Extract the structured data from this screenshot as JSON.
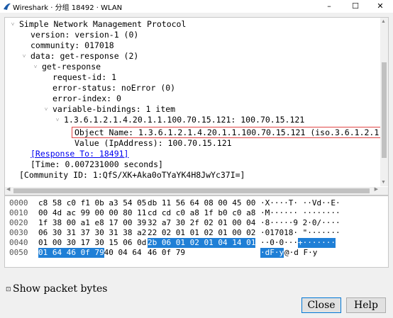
{
  "window": {
    "title": "Wireshark · 分组 18492 · WLAN",
    "minimize": "–",
    "maximize": "☐",
    "close": "✕"
  },
  "tree": {
    "rows": [
      {
        "arrow": "˅",
        "text": "Simple Network Management Protocol"
      },
      {
        "arrow": "",
        "text": "version: version-1 (0)"
      },
      {
        "arrow": "",
        "text": "community: 017018"
      },
      {
        "arrow": "˅",
        "text": "data: get-response (2)"
      },
      {
        "arrow": "˅",
        "text": "get-response"
      },
      {
        "arrow": "",
        "text": "request-id: 1"
      },
      {
        "arrow": "",
        "text": "error-status: noError (0)"
      },
      {
        "arrow": "",
        "text": "error-index: 0"
      },
      {
        "arrow": "˅",
        "text": "variable-bindings: 1 item"
      },
      {
        "arrow": "˅",
        "text": "1.3.6.1.2.1.4.20.1.1.100.70.15.121: 100.70.15.121"
      },
      {
        "arrow": "",
        "text": "Object Name: 1.3.6.1.2.1.4.20.1.1.100.70.15.121 (iso.3.6.1.2.1.4.20.1."
      },
      {
        "arrow": "",
        "text": "Value (IpAddress): 100.70.15.121"
      },
      {
        "arrow": "",
        "text": "[Response To: 18491]"
      },
      {
        "arrow": "",
        "text": "[Time: 0.007231000 seconds]"
      },
      {
        "arrow": "",
        "text": "[Community ID: 1:QfS/XK+Aka0oTYaYK4H8JwYc37I=]"
      }
    ]
  },
  "hex": {
    "rows": [
      {
        "offset": "0000",
        "h1": "c8 58 c0 f1 0b a3 54 05",
        "h2": "db 11 56 64 08 00 45 00",
        "ascii": "·X····T· ··Vd··E·"
      },
      {
        "offset": "0010",
        "h1": "00 4d ac 99 00 00 80 11",
        "h2": "cd cd c0 a8 1f b0 c0 a8",
        "ascii": "·M······ ········"
      },
      {
        "offset": "0020",
        "h1": "1f 38 00 a1 e8 17 00 39",
        "h2": "32 a7 30 2f 02 01 00 04",
        "ascii": "·8·····9 2·0/····"
      },
      {
        "offset": "0030",
        "h1": "06 30 31 37 30 31 38 a2",
        "h2": "22 02 01 01 02 01 00 02",
        "ascii": "·017018· \"·······"
      },
      {
        "offset": "0040",
        "h1": "01 00 30 17 30 15 06 0d",
        "h2": "2b 06 01 02 01 04 14 01",
        "ascii_plain": "··0·0···",
        "ascii_hl": "+·······"
      },
      {
        "offset": "0050",
        "h1": "01 64 46 0f 79",
        "h1_rest": " 40 04 64",
        "h2": "46 0f 79",
        "ascii_hl": "·dF·y",
        "ascii_plain": "@·d F·y"
      }
    ]
  },
  "show_bytes": {
    "checkbox": "⊡",
    "label": "Show packet bytes"
  },
  "buttons": {
    "close": "Close",
    "help": "Help"
  }
}
